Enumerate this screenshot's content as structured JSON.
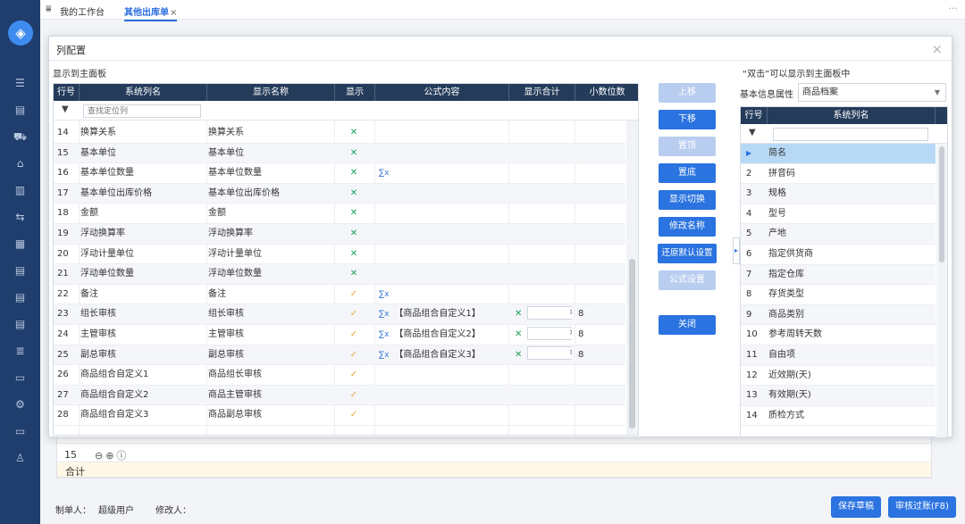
{
  "topbar": {
    "tabs": [
      {
        "label": "我的工作台"
      },
      {
        "label": "其他出库单",
        "close": "×"
      }
    ]
  },
  "footer": {
    "creator_label": "制单人：",
    "creator_value": "超级用户",
    "modifier_label": "修改人：",
    "save_draft": "保存草稿",
    "audit_post": "审核过账(F8)"
  },
  "background_table": {
    "row_number": "15",
    "total_label": "合计"
  },
  "dialog": {
    "title": "列配置",
    "close": "×",
    "left_label": "显示到主面板",
    "columns": [
      "行号",
      "系统列名",
      "显示名称",
      "显示",
      "公式内容",
      "显示合计",
      "小数位数"
    ],
    "filter_placeholder": "查找定位列",
    "rows": [
      {
        "no": "14",
        "sys": "换算关系",
        "disp": "换算关系",
        "show": "x",
        "formula": "",
        "fx": false,
        "sum": "",
        "dec": ""
      },
      {
        "no": "15",
        "sys": "基本单位",
        "disp": "基本单位",
        "show": "x",
        "formula": "",
        "fx": false,
        "sum": "",
        "dec": ""
      },
      {
        "no": "16",
        "sys": "基本单位数量",
        "disp": "基本单位数量",
        "show": "x",
        "formula": "",
        "fx": true,
        "sum": "",
        "dec": ""
      },
      {
        "no": "17",
        "sys": "基本单位出库价格",
        "disp": "基本单位出库价格",
        "show": "x",
        "formula": "",
        "fx": false,
        "sum": "",
        "dec": ""
      },
      {
        "no": "18",
        "sys": "金额",
        "disp": "金额",
        "show": "x",
        "formula": "",
        "fx": false,
        "sum": "",
        "dec": ""
      },
      {
        "no": "19",
        "sys": "浮动换算率",
        "disp": "浮动换算率",
        "show": "x",
        "formula": "",
        "fx": false,
        "sum": "",
        "dec": ""
      },
      {
        "no": "20",
        "sys": "浮动计量单位",
        "disp": "浮动计量单位",
        "show": "x",
        "formula": "",
        "fx": false,
        "sum": "",
        "dec": ""
      },
      {
        "no": "21",
        "sys": "浮动单位数量",
        "disp": "浮动单位数量",
        "show": "x",
        "formula": "",
        "fx": false,
        "sum": "",
        "dec": ""
      },
      {
        "no": "22",
        "sys": "备注",
        "disp": "备注",
        "show": "v",
        "formula": "",
        "fx": true,
        "sum": "",
        "dec": ""
      },
      {
        "no": "23",
        "sys": "组长审核",
        "disp": "组长审核",
        "show": "v",
        "formula": "【商品组合自定义1】",
        "fx": true,
        "sum": "x",
        "dec": "8"
      },
      {
        "no": "24",
        "sys": "主管审核",
        "disp": "主管审核",
        "show": "v",
        "formula": "【商品组合自定义2】",
        "fx": true,
        "sum": "x",
        "dec": "8"
      },
      {
        "no": "25",
        "sys": "副总审核",
        "disp": "副总审核",
        "show": "v",
        "formula": "【商品组合自定义3】",
        "fx": true,
        "sum": "x",
        "dec": "8"
      },
      {
        "no": "26",
        "sys": "商品组合自定义1",
        "disp": "商品组长审核",
        "show": "v",
        "formula": "",
        "fx": false,
        "sum": "",
        "dec": ""
      },
      {
        "no": "27",
        "sys": "商品组合自定义2",
        "disp": "商品主管审核",
        "show": "v",
        "formula": "",
        "fx": false,
        "sum": "",
        "dec": ""
      },
      {
        "no": "28",
        "sys": "商品组合自定义3",
        "disp": "商品副总审核",
        "show": "v",
        "formula": "",
        "fx": false,
        "sum": "",
        "dec": ""
      }
    ],
    "buttons": {
      "up": "上移",
      "down": "下移",
      "top": "置顶",
      "bottom": "置底",
      "toggle": "显示切换",
      "rename": "修改名称",
      "restore": "还原默认设置",
      "formula": "公式设置",
      "close": "关闭"
    },
    "right_hint": "“双击”可以显示到主面板中",
    "right_prop_label": "基本信息属性",
    "right_select_value": "商品档案",
    "right_columns": [
      "行号",
      "系统列名"
    ],
    "right_rows": [
      {
        "no": "",
        "name": "简名"
      },
      {
        "no": "2",
        "name": "拼音码"
      },
      {
        "no": "3",
        "name": "规格"
      },
      {
        "no": "4",
        "name": "型号"
      },
      {
        "no": "5",
        "name": "产地"
      },
      {
        "no": "6",
        "name": "指定供货商"
      },
      {
        "no": "7",
        "name": "指定仓库"
      },
      {
        "no": "8",
        "name": "存货类型"
      },
      {
        "no": "9",
        "name": "商品类别"
      },
      {
        "no": "10",
        "name": "参考周转天数"
      },
      {
        "no": "11",
        "name": "自由项"
      },
      {
        "no": "12",
        "name": "近效期(天)"
      },
      {
        "no": "13",
        "name": "有效期(天)"
      },
      {
        "no": "14",
        "name": "质检方式"
      }
    ]
  }
}
